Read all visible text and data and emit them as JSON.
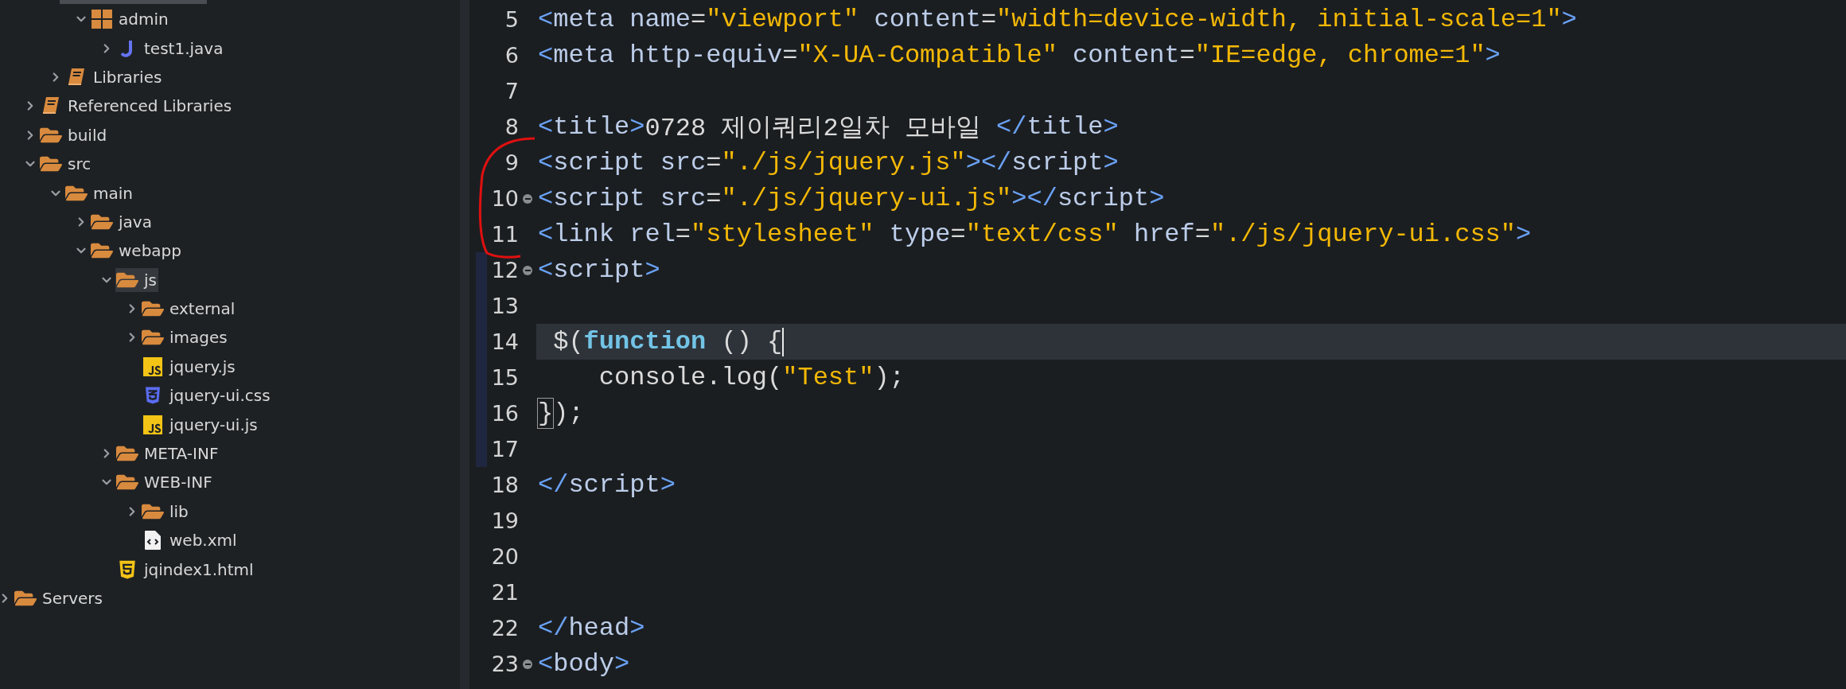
{
  "project_tree": [
    {
      "children": [
        {
          "children": [
            {
              "children": [
                {
                  "label": "admin",
                  "kind": "package",
                  "expanded": true,
                  "selected": false,
                  "children": [
                    {
                      "label": "test1.java",
                      "kind": "java",
                      "expanded": false,
                      "selected": false
                    }
                  ]
                }
              ]
            },
            {
              "label": "Libraries",
              "kind": "library",
              "expanded": false,
              "selected": false
            }
          ]
        },
        {
          "label": "Referenced Libraries",
          "kind": "library",
          "expanded": false,
          "selected": false
        },
        {
          "label": "build",
          "kind": "folder",
          "expanded": false,
          "selected": false
        },
        {
          "label": "src",
          "kind": "folder",
          "expanded": true,
          "selected": false,
          "children": [
            {
              "label": "main",
              "kind": "folder",
              "expanded": true,
              "selected": false,
              "children": [
                {
                  "label": "java",
                  "kind": "folder",
                  "expanded": false,
                  "selected": false
                },
                {
                  "label": "webapp",
                  "kind": "folder",
                  "expanded": true,
                  "selected": false,
                  "children": [
                    {
                      "label": "js",
                      "kind": "folder",
                      "expanded": true,
                      "selected": true,
                      "children": [
                        {
                          "label": "external",
                          "kind": "folder",
                          "expanded": false,
                          "selected": false
                        },
                        {
                          "label": "images",
                          "kind": "folder",
                          "expanded": false,
                          "selected": false
                        },
                        {
                          "label": "jquery.js",
                          "kind": "js",
                          "selected": false
                        },
                        {
                          "label": "jquery-ui.css",
                          "kind": "css",
                          "selected": false
                        },
                        {
                          "label": "jquery-ui.js",
                          "kind": "js",
                          "selected": false
                        }
                      ]
                    },
                    {
                      "label": "META-INF",
                      "kind": "folder",
                      "expanded": false,
                      "selected": false
                    },
                    {
                      "label": "WEB-INF",
                      "kind": "folder",
                      "expanded": true,
                      "selected": false,
                      "children": [
                        {
                          "label": "lib",
                          "kind": "folder",
                          "expanded": false,
                          "selected": false
                        },
                        {
                          "label": "web.xml",
                          "kind": "xml",
                          "selected": false
                        }
                      ]
                    },
                    {
                      "label": "jqindex1.html",
                      "kind": "html",
                      "selected": false
                    }
                  ]
                }
              ]
            }
          ]
        }
      ]
    },
    {
      "label": "Servers",
      "kind": "folder",
      "expanded": false,
      "selected": false
    }
  ],
  "editor": {
    "lines": [
      {
        "number": "5",
        "tokens": [
          {
            "kind": "punct",
            "text": "<"
          },
          {
            "kind": "tag",
            "text": "meta "
          },
          {
            "kind": "tag",
            "text": "name"
          },
          {
            "kind": "plain",
            "text": "="
          },
          {
            "kind": "string",
            "text": "\"viewport\""
          },
          {
            "kind": "tag",
            "text": " content"
          },
          {
            "kind": "plain",
            "text": "="
          },
          {
            "kind": "string",
            "text": "\"width=device-width, initial-scale=1\""
          },
          {
            "kind": "punct",
            "text": ">"
          }
        ]
      },
      {
        "number": "6",
        "tokens": [
          {
            "kind": "punct",
            "text": "<"
          },
          {
            "kind": "tag",
            "text": "meta http-equiv"
          },
          {
            "kind": "plain",
            "text": "="
          },
          {
            "kind": "string",
            "text": "\"X-UA-Compatible\""
          },
          {
            "kind": "tag",
            "text": " content"
          },
          {
            "kind": "plain",
            "text": "="
          },
          {
            "kind": "string",
            "text": "\"IE=edge, chrome=1\""
          },
          {
            "kind": "punct",
            "text": ">"
          }
        ]
      },
      {
        "number": "7"
      },
      {
        "number": "8",
        "tokens": [
          {
            "kind": "punct",
            "text": "<"
          },
          {
            "kind": "tag",
            "text": "title"
          },
          {
            "kind": "punct",
            "text": ">"
          },
          {
            "kind": "plain",
            "text": "0728 제이쿼리2일차 모바일 "
          },
          {
            "kind": "punct",
            "text": "</"
          },
          {
            "kind": "tag",
            "text": "title"
          },
          {
            "kind": "punct",
            "text": ">"
          }
        ]
      },
      {
        "number": "9",
        "tokens": [
          {
            "kind": "punct",
            "text": "<"
          },
          {
            "kind": "tag",
            "text": "script src"
          },
          {
            "kind": "plain",
            "text": "="
          },
          {
            "kind": "string",
            "text": "\"./js/jquery.js\""
          },
          {
            "kind": "punct",
            "text": "></"
          },
          {
            "kind": "tag",
            "text": "script"
          },
          {
            "kind": "punct",
            "text": ">"
          }
        ]
      },
      {
        "number": "10",
        "foldable": true,
        "tokens": [
          {
            "kind": "punct",
            "text": "<"
          },
          {
            "kind": "tag",
            "text": "script src"
          },
          {
            "kind": "plain",
            "text": "="
          },
          {
            "kind": "string",
            "text": "\"./js/jquery-ui.js\""
          },
          {
            "kind": "punct",
            "text": "></"
          },
          {
            "kind": "tag",
            "text": "script"
          },
          {
            "kind": "punct",
            "text": ">"
          }
        ]
      },
      {
        "number": "11",
        "tokens": [
          {
            "kind": "punct",
            "text": "<"
          },
          {
            "kind": "tag",
            "text": "link rel"
          },
          {
            "kind": "plain",
            "text": "="
          },
          {
            "kind": "string",
            "text": "\"stylesheet\""
          },
          {
            "kind": "tag",
            "text": " type"
          },
          {
            "kind": "plain",
            "text": "="
          },
          {
            "kind": "string",
            "text": "\"text/css\""
          },
          {
            "kind": "tag",
            "text": " href"
          },
          {
            "kind": "plain",
            "text": "="
          },
          {
            "kind": "string",
            "text": "\"./js/jquery-ui.css\""
          },
          {
            "kind": "punct",
            "text": ">"
          }
        ]
      },
      {
        "number": "12",
        "foldable": true,
        "marked": true,
        "tokens": [
          {
            "kind": "punct",
            "text": "<"
          },
          {
            "kind": "tag",
            "text": "script"
          },
          {
            "kind": "punct",
            "text": ">"
          }
        ]
      },
      {
        "number": "13",
        "marked": true
      },
      {
        "number": "14",
        "marked": true,
        "current": true,
        "tokens": [
          {
            "kind": "plain",
            "text": " $("
          },
          {
            "kind": "keyword",
            "text": "function"
          },
          {
            "kind": "plain",
            "text": " () {"
          }
        ]
      },
      {
        "number": "15",
        "marked": true,
        "tokens": [
          {
            "kind": "plain",
            "text": "    console.log("
          },
          {
            "kind": "string",
            "text": "\"Test\""
          },
          {
            "kind": "plain",
            "text": ");"
          }
        ]
      },
      {
        "number": "16",
        "marked": true,
        "tokens": [
          {
            "kind": "plain",
            "text": "}",
            "matched": true
          },
          {
            "kind": "plain",
            "text": ");"
          }
        ]
      },
      {
        "number": "17",
        "marked": true
      },
      {
        "number": "18",
        "tokens": [
          {
            "kind": "punct",
            "text": "</"
          },
          {
            "kind": "tag",
            "text": "script"
          },
          {
            "kind": "punct",
            "text": ">"
          }
        ]
      },
      {
        "number": "19"
      },
      {
        "number": "20"
      },
      {
        "number": "21"
      },
      {
        "number": "22",
        "tokens": [
          {
            "kind": "punct",
            "text": "</"
          },
          {
            "kind": "tag",
            "text": "head"
          },
          {
            "kind": "punct",
            "text": ">"
          }
        ]
      },
      {
        "number": "23",
        "foldable": true,
        "tokens": [
          {
            "kind": "punct",
            "text": "<"
          },
          {
            "kind": "tag",
            "text": "body"
          },
          {
            "kind": "punct",
            "text": ">"
          }
        ]
      }
    ]
  }
}
